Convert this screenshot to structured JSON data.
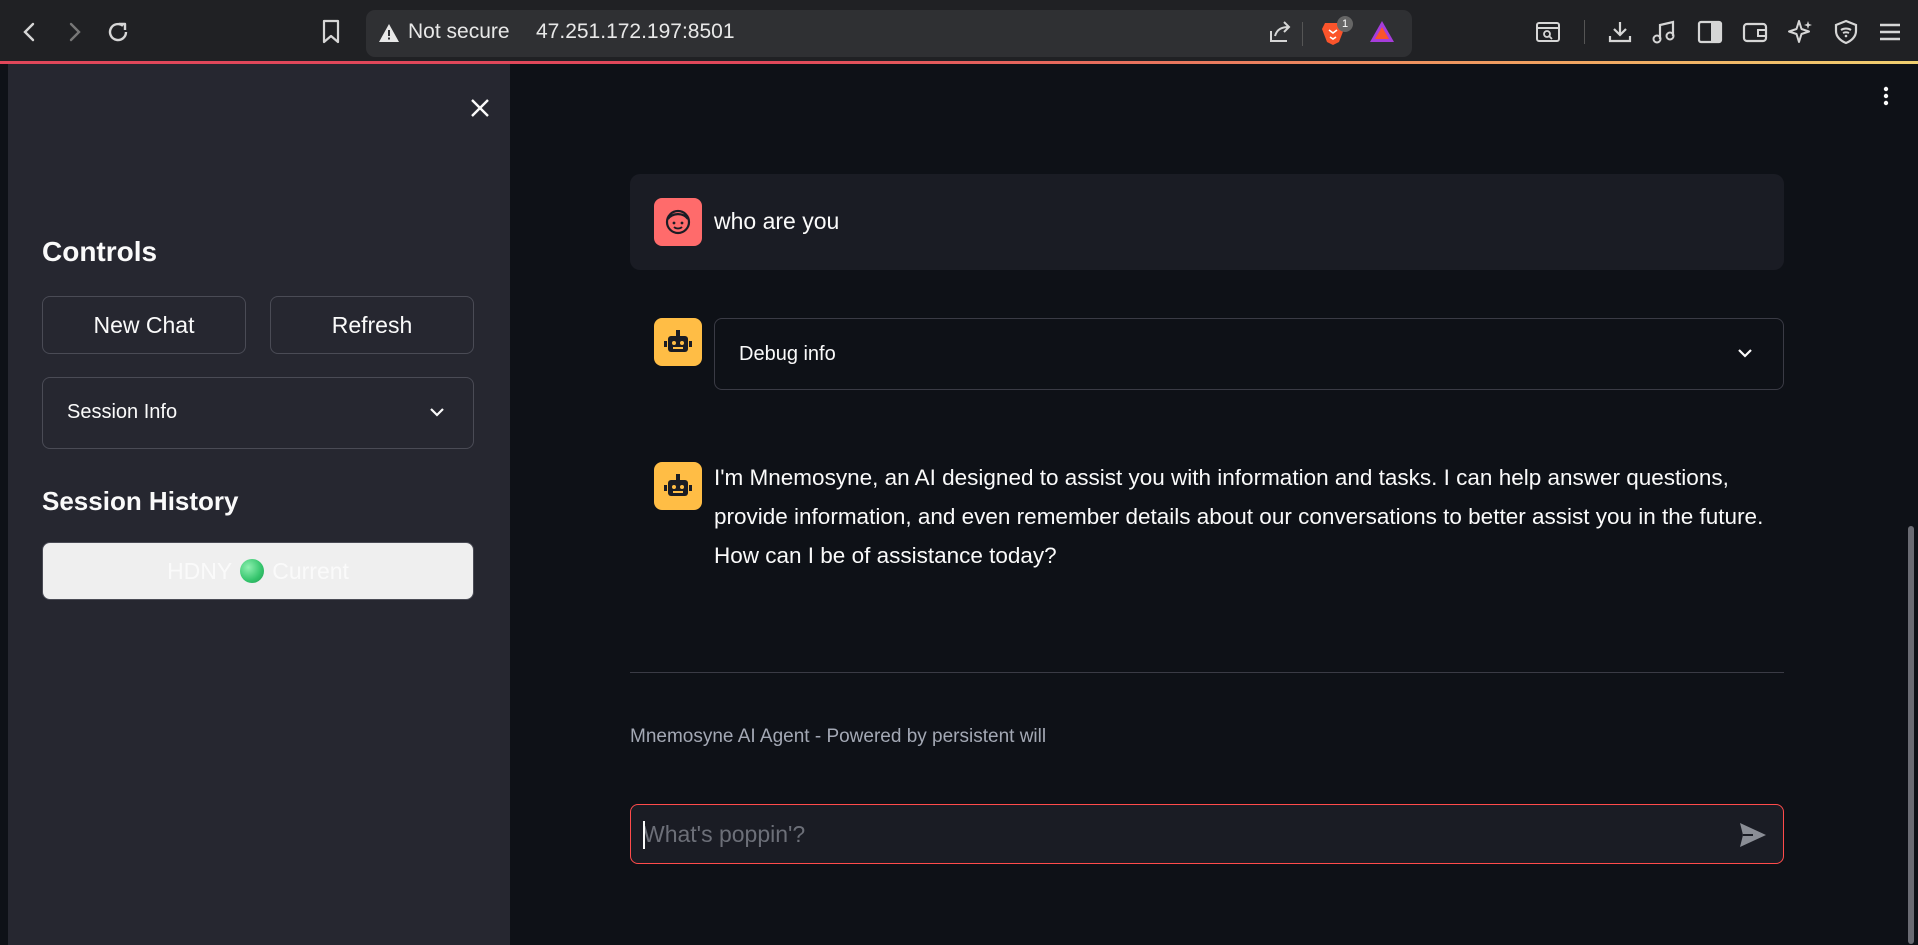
{
  "browser": {
    "security_label": "Not secure",
    "url": "47.251.172.197:8501",
    "brave_badge_count": "1"
  },
  "sidebar": {
    "controls_heading": "Controls",
    "new_chat_label": "New Chat",
    "refresh_label": "Refresh",
    "session_info_label": "Session Info",
    "history_heading": "Session History",
    "history_items": [
      {
        "name": "HDNY",
        "status": "Current"
      }
    ]
  },
  "chat": {
    "messages": [
      {
        "role": "user",
        "text": "who are you"
      },
      {
        "role": "assistant",
        "expander_label": "Debug info"
      },
      {
        "role": "assistant",
        "text": "I'm Mnemosyne, an AI designed to assist you with information and tasks. I can help answer questions, provide information, and even remember details about our conversations to better assist you in the future. How can I be of assistance today?"
      }
    ],
    "footer": "Mnemosyne AI Agent - Powered by persistent will",
    "input_placeholder": "What's poppin'?",
    "input_value": ""
  },
  "colors": {
    "accent": "#ff4b4b",
    "user_avatar": "#ff6b6b",
    "bot_avatar": "#ffbd45",
    "sidebar_bg": "#262730",
    "main_bg": "#0e1117"
  }
}
